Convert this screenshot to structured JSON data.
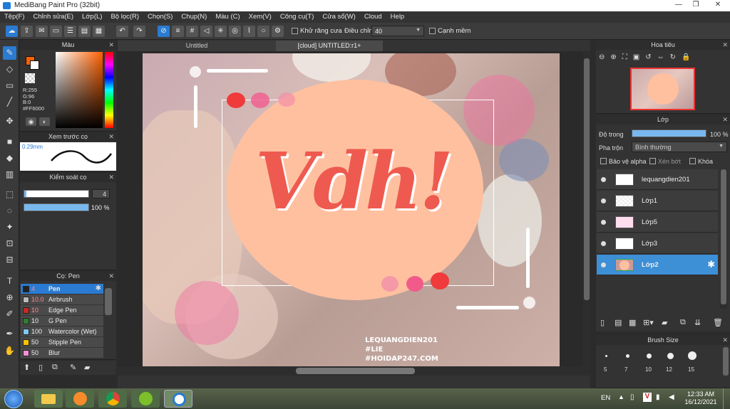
{
  "window": {
    "title": "MediBang Paint Pro (32bit)"
  },
  "menu": [
    "Tệp(F)",
    "Chỉnh sửa(E)",
    "Lớp(L)",
    "Bộ lọc(R)",
    "Chọn(S)",
    "Chụp(N)",
    "Màu (C)",
    "Xem(V)",
    "Công cụ(T)",
    "Cửa sổ(W)",
    "Cloud",
    "Help"
  ],
  "toolbar": {
    "antialias_label": "Khử răng cưa",
    "adjust_label": "Điều chỉnh",
    "adjust_value": "40",
    "sharp_label": "Cạnh mềm"
  },
  "color_panel": {
    "title": "Màu",
    "r": "R:255",
    "g": "G:96",
    "b": "B:0",
    "hex": "#FF6000",
    "primary_color": "#ff6000"
  },
  "preview_panel": {
    "title": "Xem trước cọ",
    "size": "0.29mm"
  },
  "brush_control": {
    "title": "Kiểm soát cọ",
    "size_value": "4",
    "opacity_value": "100 %",
    "opacity": 1.0
  },
  "brush_panel": {
    "title": "Cọ: Pen",
    "items": [
      {
        "size": "4",
        "name": "Pen",
        "color": "#222222"
      },
      {
        "size": "10.0",
        "name": "Airbrush",
        "color": "#bbbbbb"
      },
      {
        "size": "10",
        "name": "Edge Pen",
        "color": "#c62828"
      },
      {
        "size": "10",
        "name": "G Pen",
        "color": "#2e7d32"
      },
      {
        "size": "100",
        "name": "Watercolor (Wet)",
        "color": "#7ec8f0"
      },
      {
        "size": "50",
        "name": "Stipple Pen",
        "color": "#f5c400"
      },
      {
        "size": "50",
        "name": "Blur",
        "color": "#f48fd6"
      }
    ]
  },
  "tabs": [
    {
      "label": "Untitled"
    },
    {
      "label": "[cloud] UNTITLED:r1+"
    }
  ],
  "canvas": {
    "lettering": "Vdh!",
    "credit_line1": "LEQUANGDIEN201",
    "credit_line2": "#LIE",
    "credit_line3": "#HOIDAP247.COM"
  },
  "navigator": {
    "title": "Hoa tiêu"
  },
  "layer_panel": {
    "title": "Lớp",
    "opacity_label": "Độ trong",
    "opacity_value": "100 %",
    "opacity": 1.0,
    "blend_label": "Pha trộn",
    "blend_value": "Bình thường",
    "protect_alpha": "Bảo vệ alpha",
    "clipping": "Xén bớt",
    "lock": "Khóa",
    "layers": [
      {
        "name": "lequangdien201"
      },
      {
        "name": "Lớp1"
      },
      {
        "name": "Lớp5"
      },
      {
        "name": "Lớp3"
      },
      {
        "name": "Lớp2"
      }
    ]
  },
  "brush_size_panel": {
    "title": "Brush Size",
    "sizes": [
      "5",
      "7",
      "10",
      "12",
      "15"
    ]
  },
  "taskbar": {
    "lang": "EN",
    "time": "12:33 AM",
    "date": "16/12/2021"
  }
}
